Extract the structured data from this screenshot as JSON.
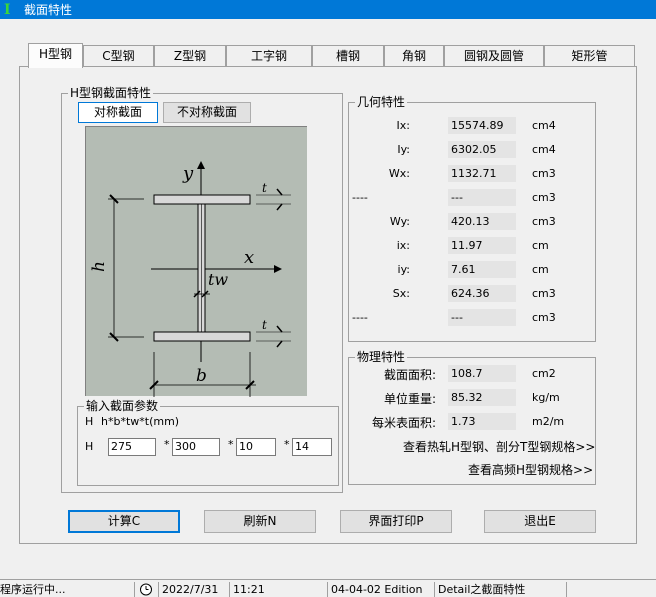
{
  "window": {
    "title": "截面特性"
  },
  "tabs": [
    "H型钢",
    "C型钢",
    "Z型钢",
    "工字钢",
    "槽钢",
    "角钢",
    "圆钢及圆管",
    "矩形管"
  ],
  "h_section": {
    "title": "H型钢截面特性",
    "sym_button": "对称截面",
    "asym_button": "不对称截面"
  },
  "drawing_labels": {
    "y": "y",
    "x": "x",
    "h": "h",
    "b": "b",
    "tw": "tw",
    "t_top": "t",
    "t_bottom": "t"
  },
  "input_group": {
    "title": "输入截面参数",
    "formula_prefix": "H",
    "formula": "h*b*tw*t(mm)",
    "row_prefix": "H",
    "sep": "*",
    "values": [
      "275",
      "300",
      "10",
      "14"
    ]
  },
  "geometry": {
    "title": "几何特性",
    "rows": [
      {
        "label": "Ix:",
        "value": "15574.89",
        "unit": "cm4"
      },
      {
        "label": "Iy:",
        "value": "6302.05",
        "unit": "cm4"
      },
      {
        "label": "Wx:",
        "value": "1132.71",
        "unit": "cm3"
      },
      {
        "label": "----",
        "value": "---",
        "unit": "cm3"
      },
      {
        "label": "Wy:",
        "value": "420.13",
        "unit": "cm3"
      },
      {
        "label": "ix:",
        "value": "11.97",
        "unit": "cm"
      },
      {
        "label": "iy:",
        "value": "7.61",
        "unit": "cm"
      },
      {
        "label": "Sx:",
        "value": "624.36",
        "unit": "cm3"
      },
      {
        "label": "----",
        "value": "---",
        "unit": "cm3"
      }
    ]
  },
  "physical": {
    "title": "物理特性",
    "rows": [
      {
        "label": "截面面积:",
        "value": "108.7",
        "unit": "cm2"
      },
      {
        "label": "单位重量:",
        "value": "85.32",
        "unit": "kg/m"
      },
      {
        "label": "每米表面积:",
        "value": "1.73",
        "unit": "m2/m"
      }
    ],
    "link1": "查看热轧H型钢、剖分T型钢规格>>",
    "link2": "查看高频H型钢规格>>"
  },
  "buttons": {
    "calc": "计算C",
    "refresh": "刷新N",
    "print": "界面打印P",
    "exit": "退出E"
  },
  "status": {
    "running": "程序运行中...",
    "date": "2022/7/31",
    "time": "11:21",
    "edition": "04-04-02 Edition",
    "detail": "Detail之截面特性"
  },
  "colors": {
    "titlebar": "#0078d7",
    "drawing_bg": "#b4bcb4"
  }
}
